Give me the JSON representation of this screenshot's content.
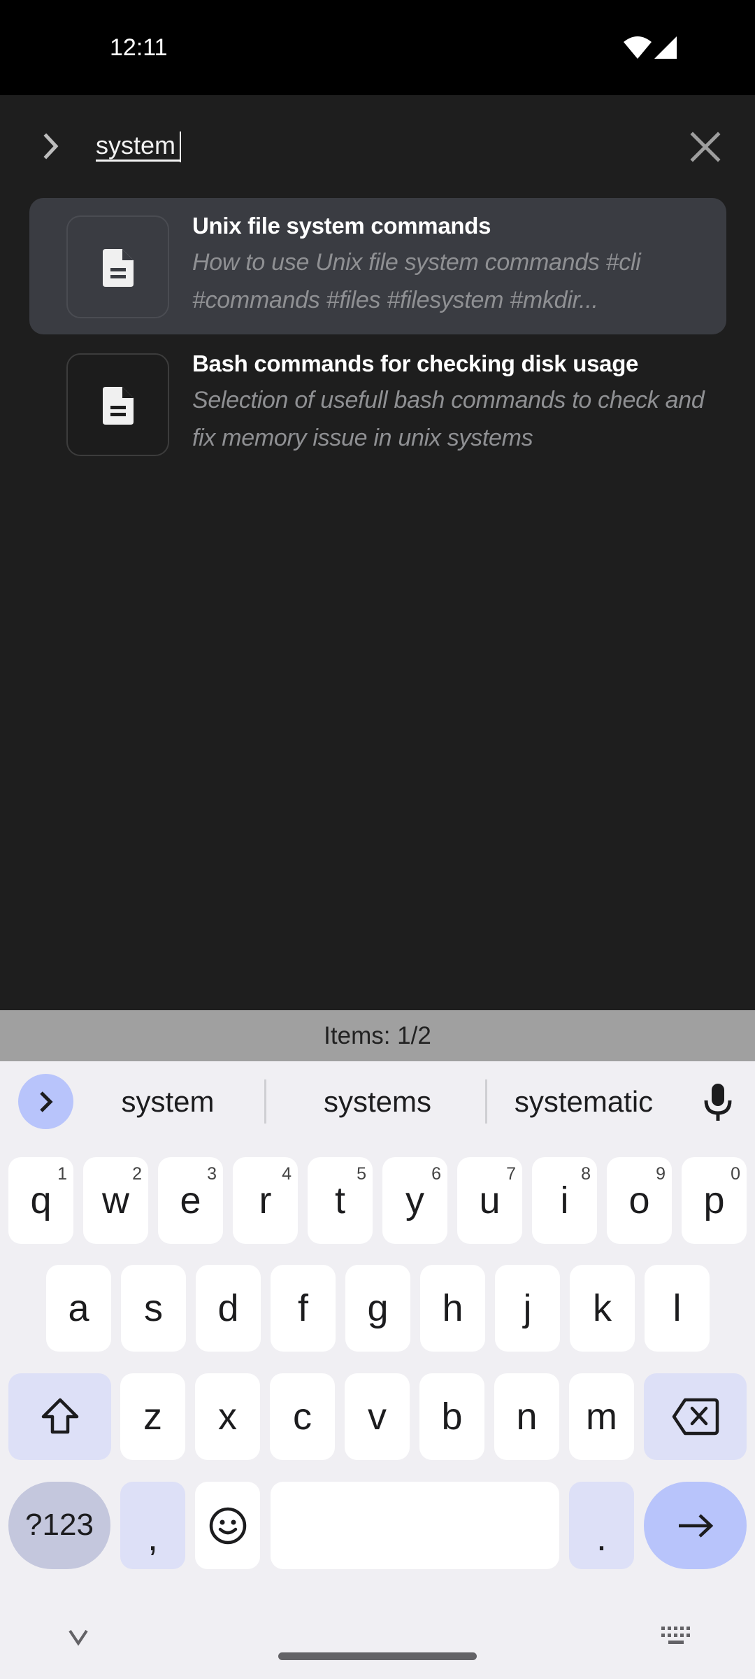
{
  "status_bar": {
    "time": "12:11",
    "icons": [
      "wifi-icon",
      "signal-icon"
    ]
  },
  "search": {
    "back_icon": "chevron-right-icon",
    "value": "system",
    "clear_icon": "close-icon"
  },
  "results": [
    {
      "icon": "document-icon",
      "title": "Unix file system commands",
      "description": "How to use Unix file system commands #cli #commands #files #filesystem #mkdir...",
      "selected": true
    },
    {
      "icon": "document-icon",
      "title": "Bash commands for checking disk usage",
      "description": "Selection of usefull bash commands to check and fix memory issue in unix systems",
      "selected": false
    }
  ],
  "items_status": "Items: 1/2",
  "keyboard": {
    "suggestions": [
      "system",
      "systems",
      "systematic"
    ],
    "row1": [
      {
        "key": "q",
        "hint": "1"
      },
      {
        "key": "w",
        "hint": "2"
      },
      {
        "key": "e",
        "hint": "3"
      },
      {
        "key": "r",
        "hint": "4"
      },
      {
        "key": "t",
        "hint": "5"
      },
      {
        "key": "y",
        "hint": "6"
      },
      {
        "key": "u",
        "hint": "7"
      },
      {
        "key": "i",
        "hint": "8"
      },
      {
        "key": "o",
        "hint": "9"
      },
      {
        "key": "p",
        "hint": "0"
      }
    ],
    "row2": [
      "a",
      "s",
      "d",
      "f",
      "g",
      "h",
      "j",
      "k",
      "l"
    ],
    "row3": [
      "z",
      "x",
      "c",
      "v",
      "b",
      "n",
      "m"
    ],
    "symbols_label": "?123",
    "comma": ",",
    "period": ".",
    "colors": {
      "background": "#f0eff3",
      "key": "#ffffff",
      "special_key": "#dde0f7",
      "accent": "#b8c4fb"
    }
  },
  "colors": {
    "app_background": "#1e1e1e",
    "selected_card": "#3a3c42",
    "items_bar": "#a0a0a0"
  }
}
